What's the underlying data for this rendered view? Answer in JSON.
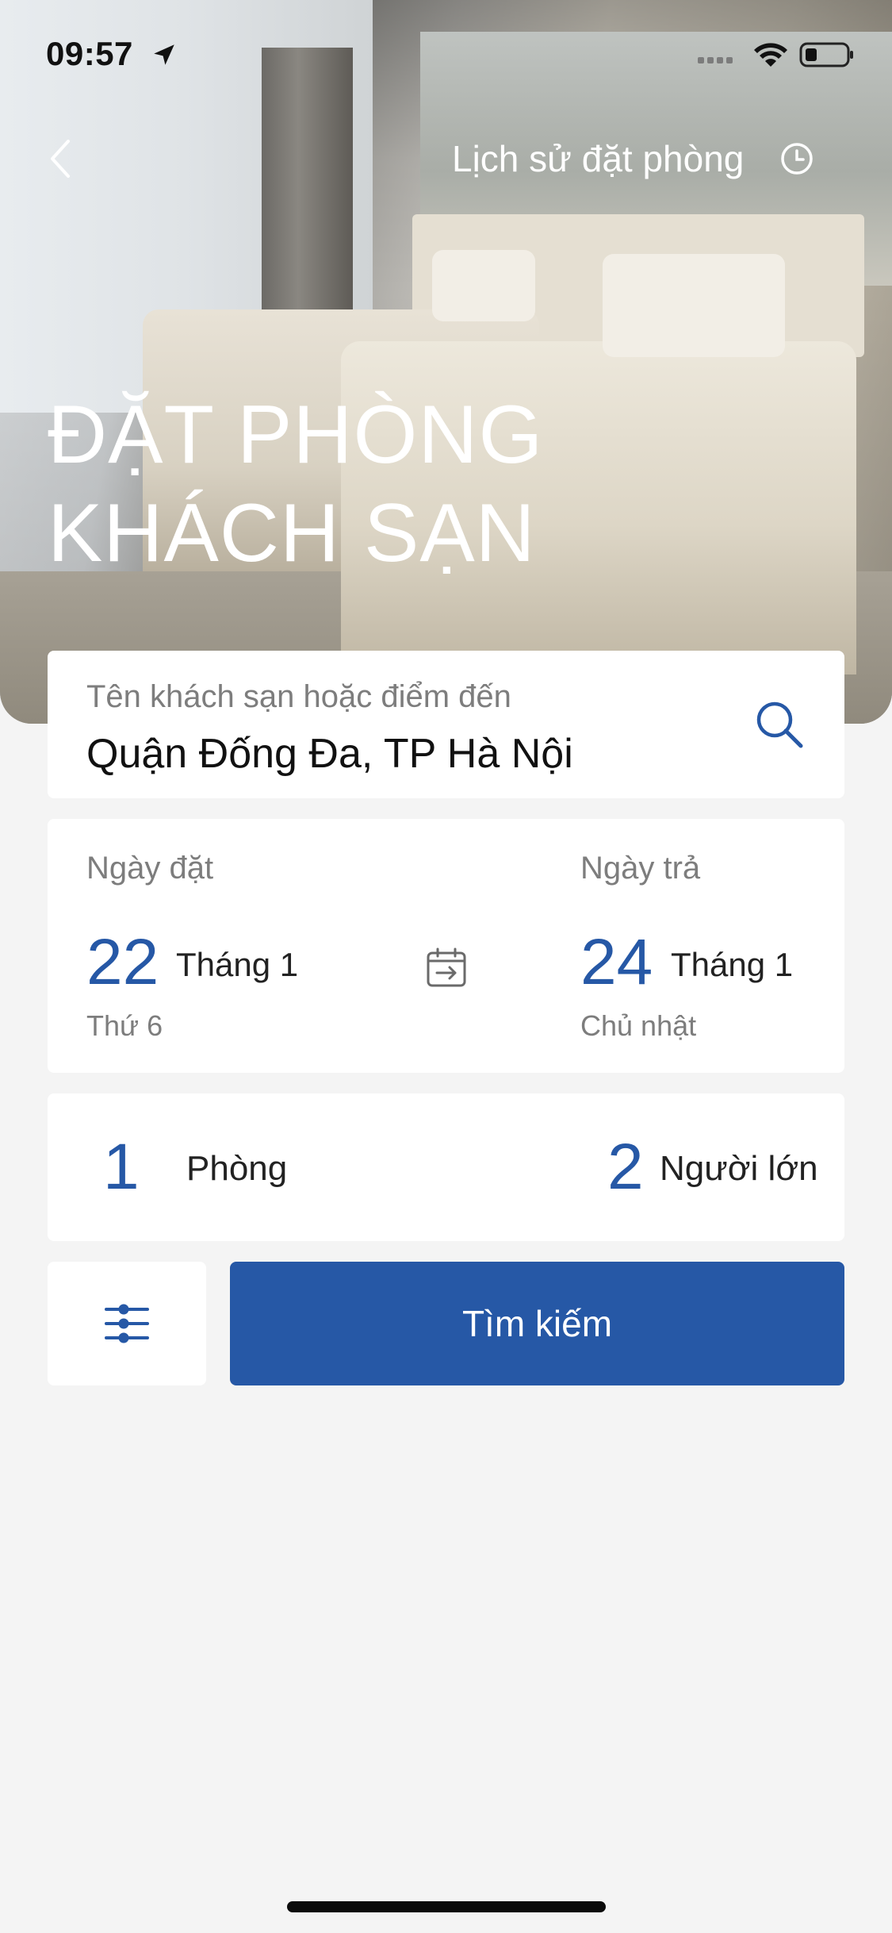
{
  "status_bar": {
    "time": "09:57",
    "icons": [
      "location-arrow-icon",
      "cellular-signal-icon",
      "wifi-icon",
      "battery-icon"
    ]
  },
  "header": {
    "back_icon": "chevron-left-icon",
    "history_label": "Lịch sử đặt phòng",
    "history_icon": "clock-icon",
    "title_line1": "ĐẶT PHÒNG",
    "title_line2": "KHÁCH SẠN"
  },
  "search": {
    "placeholder": "Tên khách sạn hoặc điểm đến",
    "value": "Quận Đống Đa, TP Hà Nội",
    "icon": "search-icon"
  },
  "dates": {
    "checkin": {
      "label": "Ngày đặt",
      "day": "22",
      "month": "Tháng 1",
      "weekday": "Thứ 6"
    },
    "checkout": {
      "label": "Ngày trả",
      "day": "24",
      "month": "Tháng 1",
      "weekday": "Chủ nhật"
    },
    "icon": "calendar-arrow-icon"
  },
  "guests": {
    "rooms_count": "1",
    "rooms_label": "Phòng",
    "adults_count": "2",
    "adults_label": "Người lớn"
  },
  "actions": {
    "filter_icon": "sliders-icon",
    "search_label": "Tìm kiếm"
  },
  "colors": {
    "accent": "#2658a6",
    "background": "#f4f4f4",
    "card": "#ffffff",
    "muted_text": "#7d7d7d"
  }
}
